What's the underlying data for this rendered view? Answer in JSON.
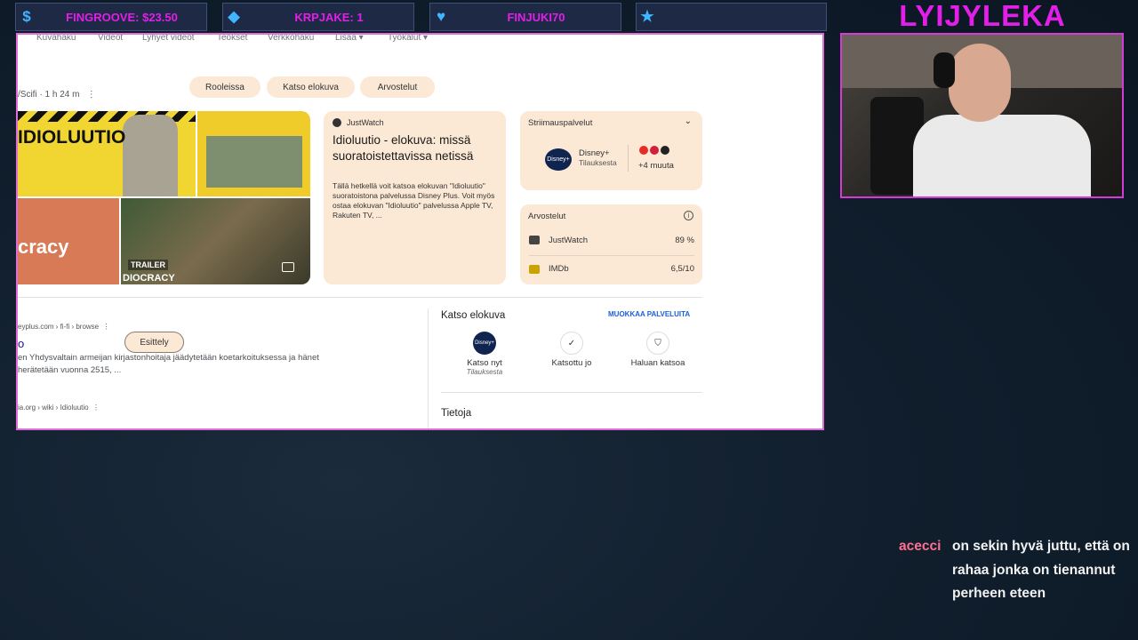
{
  "alerts": [
    {
      "icon": "$",
      "icon_name": "dollar-icon",
      "text": "FINGROOVE: $23.50"
    },
    {
      "icon": "◆",
      "icon_name": "gem-icon",
      "text": "KRPJAKE: 1"
    },
    {
      "icon": "♥",
      "icon_name": "heart-icon",
      "text": "FINJUKI70"
    },
    {
      "icon": "★",
      "icon_name": "star-icon",
      "text": ""
    }
  ],
  "streamer": {
    "name": "LYIJYLEKA"
  },
  "browser": {
    "nav": [
      "Kuvahaku",
      "Videot",
      "Lyhyet videot",
      "Teokset",
      "Verkkohaku",
      "Lisää ▾",
      "Työkalut ▾"
    ],
    "meta": "/Scifi · 1 h 24 m",
    "chips": [
      "Esittely",
      "Rooleissa",
      "Katso elokuva",
      "Arvostelut"
    ],
    "images": {
      "title1": "IDIOLUUTIO",
      "title3": "cracy",
      "trailer": "TRAILER",
      "title4": "DIOCRACY"
    },
    "justwatch": {
      "source": "JustWatch",
      "heading": "Idioluutio - elokuva: missä suoratoistettavissa netissä",
      "desc": "Tällä hetkellä voit katsoa elokuvan \"Idioluutio\" suoratoistona palvelussa Disney Plus. Voit myös ostaa elokuvan \"Idioluutio\" palvelussa Apple TV, Rakuten TV, ..."
    },
    "streaming": {
      "label": "Striimauspalvelut",
      "service": "Disney+",
      "service_sub": "Tilauksesta",
      "more": "+4 muuta",
      "disney_logo": "Disney+"
    },
    "ratings": {
      "label": "Arvostelut",
      "rows": [
        {
          "name": "JustWatch",
          "score": "89 %"
        },
        {
          "name": "IMDb",
          "score": "6,5/10"
        }
      ]
    },
    "results": [
      {
        "url": "eyplus.com › fi-fi › browse",
        "title": "o",
        "snippet": "en Yhdysvaltain armeijan kirjastonhoitaja jäädytetään koetarkoituksessa ja hänet herätetään vuonna 2515, ..."
      },
      {
        "url": "ia.org › wiki › Idioluutio"
      }
    ],
    "watch": {
      "heading": "Katso elokuva",
      "edit": "MUOKKAA PALVELUITA",
      "actions": [
        {
          "label": "Katso nyt",
          "sub": "Tilauksesta",
          "icon": "Disney+"
        },
        {
          "label": "Katsottu jo",
          "sub": "",
          "icon": "✓"
        },
        {
          "label": "Haluan katsoa",
          "sub": "",
          "icon": "⛉"
        }
      ]
    },
    "info_heading": "Tietoja"
  },
  "chat": {
    "user": "acecci",
    "message": "on sekin hyvä juttu, että on rahaa jonka on tienannut perheen eteen"
  }
}
